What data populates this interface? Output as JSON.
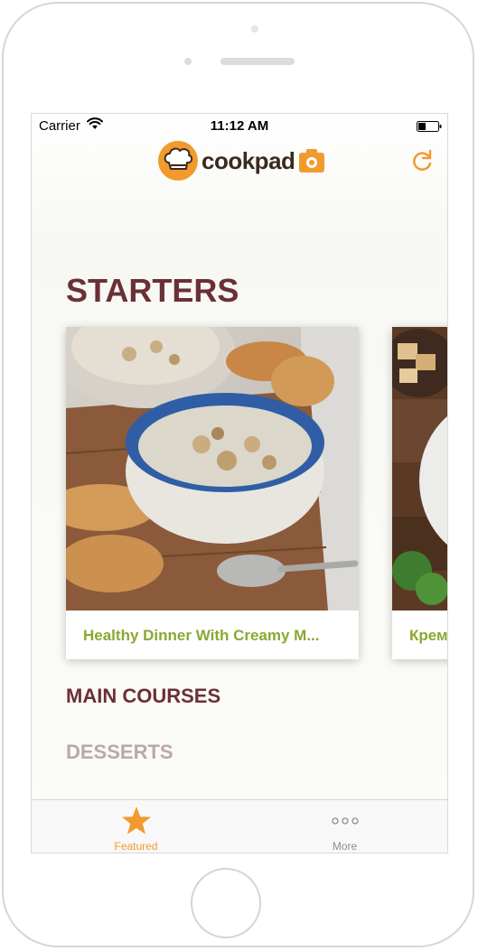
{
  "status_bar": {
    "carrier": "Carrier",
    "time": "11:12 AM"
  },
  "header": {
    "logo_text": "cookpad",
    "logo_icon": "chef-hat-icon",
    "refresh_icon": "refresh-icon"
  },
  "sections": [
    {
      "title": "STARTERS",
      "cards": [
        {
          "title": "Healthy Dinner With Creamy M...",
          "image": "mushroom-soup-photo"
        },
        {
          "title": "Крем",
          "image": "bread-and-greens-photo"
        }
      ]
    },
    {
      "title": "MAIN COURSES"
    },
    {
      "title": "DESSERTS"
    }
  ],
  "tab_bar": {
    "tabs": [
      {
        "label": "Featured",
        "icon": "star-icon",
        "selected": true
      },
      {
        "label": "More",
        "icon": "more-dots-icon",
        "selected": false
      }
    ]
  },
  "colors": {
    "accent": "#f29a2e",
    "section_title": "#6a3036",
    "section_title_faded": "#bca7a9",
    "card_title": "#8aa832"
  }
}
